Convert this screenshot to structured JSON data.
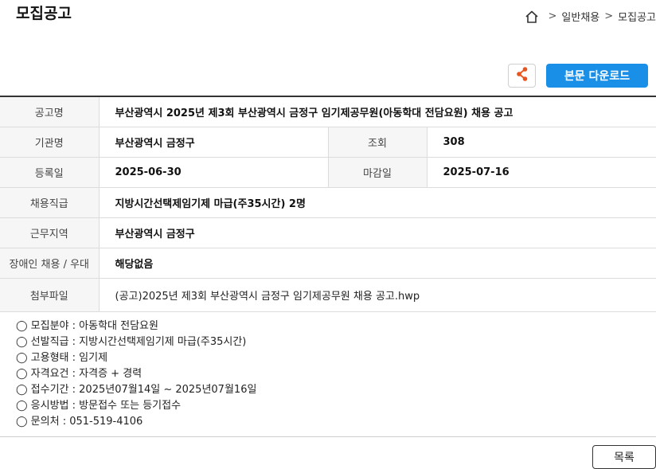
{
  "header": {
    "title": "모집공고"
  },
  "breadcrumb": {
    "home_icon": "home-icon",
    "separator": ">",
    "items": [
      "일반채용",
      "모집공고"
    ]
  },
  "actions": {
    "share_icon": "share-icon",
    "download_label": "본문 다운로드",
    "accent_color": "#1a8fe8",
    "share_icon_color": "#e8541e"
  },
  "detail": {
    "title_label": "공고명",
    "title_value": "부산광역시 2025년 제3회 부산광역시 금정구 임기제공무원(아동학대 전담요원) 채용 공고",
    "org_label": "기관명",
    "org_value": "부산광역시 금정구",
    "views_label": "조회",
    "views_value": "308",
    "reg_label": "등록일",
    "reg_value": "2025-06-30",
    "deadline_label": "마감일",
    "deadline_value": "2025-07-16",
    "grade_label": "채용직급",
    "grade_value": "지방시간선택제임기제 마급(주35시간) 2명",
    "region_label": "근무지역",
    "region_value": "부산광역시 금정구",
    "disabled_label": "장애인 채용 / 우대",
    "disabled_value": "해당없음",
    "attach_label": "첨부파일",
    "attach_value": "(공고)2025년 제3회 부산광역시 금정구 임기제공무원 채용 공고.hwp"
  },
  "body": {
    "lines": [
      "◯ 모집분야 : 아동학대 전담요원",
      "◯ 선발직급 : 지방시간선택제임기제 마급(주35시간)",
      "◯ 고용형태 : 임기제",
      "◯ 자격요건 : 자격증 + 경력",
      "◯ 접수기간 : 2025년07월14일 ~ 2025년07월16일",
      "◯ 응시방법 : 방문접수 또는 등기접수",
      "◯ 문의처 : 051-519-4106"
    ]
  },
  "footer": {
    "list_label": "목록"
  }
}
